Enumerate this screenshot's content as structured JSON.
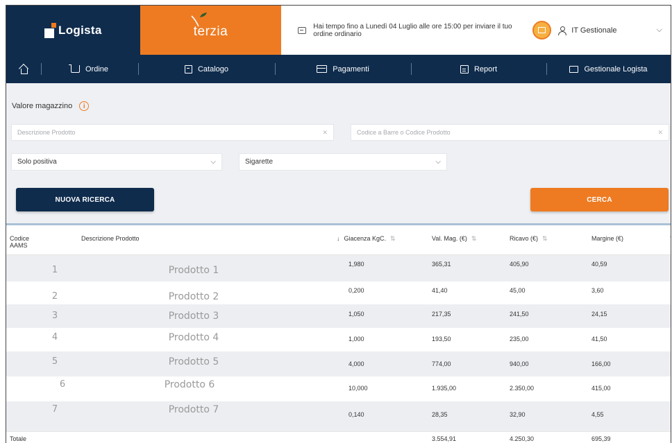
{
  "header": {
    "logista_logo": "Logista",
    "terzia_logo": "terzia",
    "notice": "Hai tempo fino a Lunedì 04 Luglio alle ore 15:00 per inviare il tuo ordine ordinario",
    "user_label": "IT Gestionale"
  },
  "nav": {
    "items": [
      {
        "label": "Ordine"
      },
      {
        "label": "Catalogo"
      },
      {
        "label": "Pagamenti"
      },
      {
        "label": "Report"
      },
      {
        "label": "Gestionale Logista"
      }
    ]
  },
  "page": {
    "title": "Valore magazzino",
    "desc_placeholder": "Descrizione Prodotto",
    "code_placeholder": "Codice a Barre o Codice Prodotto",
    "filter_value": "Solo positiva",
    "category_value": "Sigarette",
    "new_search_label": "NUOVA RICERCA",
    "search_label": "CERCA"
  },
  "table": {
    "headers": {
      "code": "Codice AAMS",
      "desc": "Descrizione Prodotto",
      "giacenza": "Giacenza KgC.",
      "val": "Val. Mag. (€)",
      "ricavo": "Ricavo (€)",
      "margine": "Margine (€)"
    },
    "rows": [
      {
        "code": "1",
        "desc": "Prodotto 1",
        "giacenza": "1,980",
        "val": "365,31",
        "ricavo": "405,90",
        "margine": "40,59"
      },
      {
        "code": "2",
        "desc": "Prodotto 2",
        "giacenza": "0,200",
        "val": "41,40",
        "ricavo": "45,00",
        "margine": "3,60"
      },
      {
        "code": "3",
        "desc": "Prodotto 3",
        "giacenza": "1,050",
        "val": "217,35",
        "ricavo": "241,50",
        "margine": "24,15"
      },
      {
        "code": "4",
        "desc": "Prodotto 4",
        "giacenza": "1,000",
        "val": "193,50",
        "ricavo": "235,00",
        "margine": "41,50"
      },
      {
        "code": "5",
        "desc": "Prodotto 5",
        "giacenza": "4,000",
        "val": "774,00",
        "ricavo": "940,00",
        "margine": "166,00"
      },
      {
        "code": "6",
        "desc": "Prodotto 6",
        "giacenza": "10,000",
        "val": "1.935,00",
        "ricavo": "2.350,00",
        "margine": "415,00"
      },
      {
        "code": "7",
        "desc": "Prodotto 7",
        "giacenza": "0,140",
        "val": "28,35",
        "ricavo": "32,90",
        "margine": "4,55"
      }
    ],
    "total": {
      "label": "Totale",
      "val": "3.554,91",
      "ricavo": "4.250,30",
      "margine": "695,39"
    }
  }
}
